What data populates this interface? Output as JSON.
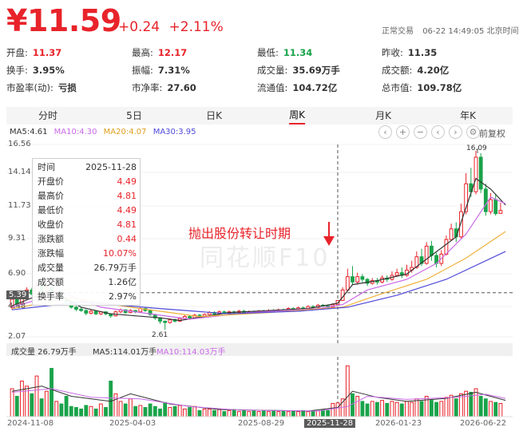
{
  "quote": {
    "price": "¥11.59",
    "change": "+0.24",
    "change_pct": "+2.11%",
    "status": "正常交易",
    "time": "06-22 14:49:05 北京时间",
    "fields": [
      {
        "label": "开盘:",
        "value": "11.37",
        "color": "red"
      },
      {
        "label": "最高:",
        "value": "12.17",
        "color": "red"
      },
      {
        "label": "最低:",
        "value": "11.34",
        "color": "green"
      },
      {
        "label": "昨收:",
        "value": "11.35",
        "color": ""
      },
      {
        "label": "换手:",
        "value": "3.95%",
        "color": ""
      },
      {
        "label": "振幅:",
        "value": "7.31%",
        "color": ""
      },
      {
        "label": "成交量:",
        "value": "35.69万手",
        "color": ""
      },
      {
        "label": "成交额:",
        "value": "4.20亿",
        "color": ""
      },
      {
        "label": "市盈率(动):",
        "value": "亏损",
        "color": ""
      },
      {
        "label": "市净率:",
        "value": "27.60",
        "color": ""
      },
      {
        "label": "流通值:",
        "value": "104.72亿",
        "color": ""
      },
      {
        "label": "总市值:",
        "value": "109.78亿",
        "color": ""
      }
    ]
  },
  "tabs": [
    "分时",
    "5日",
    "日K",
    "周K",
    "月K",
    "年K"
  ],
  "active_tab": "周K",
  "ma_legend": {
    "ma5": "MA5:4.61",
    "ma10": "MA10:4.30",
    "ma20": "MA20:4.07",
    "ma30": "MA30:3.95"
  },
  "toolbar": {
    "prev_icon": "chevron-left-icon",
    "zoom_in_icon": "plus-icon",
    "zoom_out_icon": "minus-icon",
    "back_icon": "chevron-left-icon",
    "forward_icon": "chevron-right-icon",
    "settings_icon": "gear-icon",
    "restore_label": "前复权"
  },
  "tooltip": {
    "rows": [
      {
        "k": "时间",
        "v": "2025-11-28",
        "c": "#333333"
      },
      {
        "k": "开盘价",
        "v": "4.49",
        "c": "#e8232a"
      },
      {
        "k": "最高价",
        "v": "4.81",
        "c": "#e8232a"
      },
      {
        "k": "最低价",
        "v": "4.49",
        "c": "#e8232a"
      },
      {
        "k": "收盘价",
        "v": "4.81",
        "c": "#e8232a"
      },
      {
        "k": "涨跌额",
        "v": "0.44",
        "c": "#e8232a"
      },
      {
        "k": "涨跌幅",
        "v": "10.07%",
        "c": "#e8232a"
      },
      {
        "k": "成交量",
        "v": "26.79万手",
        "c": "#333333"
      },
      {
        "k": "成交额",
        "v": "1.26亿",
        "c": "#333333"
      },
      {
        "k": "换手率",
        "v": "2.97%",
        "c": "#333333"
      }
    ]
  },
  "volume_header": {
    "vol": "成交量 26.79万手",
    "ma5": "MA5:114.01万手",
    "ma10": "MA10:114.03万手"
  },
  "annotation": "抛出股份转让时期",
  "watermark": "同花顺F10",
  "colors": {
    "up": "#e8232a",
    "down": "#1aa34a",
    "ma5": "#333333",
    "ma10": "#c96ae6",
    "ma20": "#f0b13a",
    "ma30": "#4f49d8"
  },
  "chart_data": {
    "type": "candlestick",
    "period": "weekly",
    "y_axis_labels": [
      "16.56",
      "14.14",
      "11.73",
      "9.31",
      "6.90",
      "4.48",
      "2.07"
    ],
    "ylim": [
      2.07,
      16.56
    ],
    "reference_price": "5.39",
    "max_label": "16.09",
    "min_label": "2.61",
    "x_labels": [
      "2024-11-08",
      "2025-04-03",
      "2025-08-29",
      "2025-11-28",
      "2026-01-23",
      "2026-06-22"
    ],
    "highlight_date": "2025-11-28",
    "candles": [
      [
        4.3,
        4.9,
        4.95,
        4.1
      ],
      [
        4.9,
        4.55,
        5.0,
        4.45
      ],
      [
        4.55,
        5.1,
        5.25,
        4.5
      ],
      [
        5.1,
        5.6,
        5.8,
        5.0
      ],
      [
        5.6,
        5.3,
        5.75,
        5.2
      ],
      [
        5.3,
        5.95,
        6.2,
        5.25
      ],
      [
        5.95,
        5.5,
        6.0,
        5.35
      ],
      [
        5.5,
        5.8,
        5.95,
        5.3
      ],
      [
        5.8,
        5.3,
        5.85,
        5.2
      ],
      [
        5.3,
        5.45,
        5.6,
        5.1
      ],
      [
        5.45,
        4.95,
        5.5,
        4.8
      ],
      [
        4.95,
        4.7,
        5.05,
        4.5
      ],
      [
        4.7,
        4.3,
        4.75,
        4.2
      ],
      [
        4.3,
        4.15,
        4.4,
        4.0
      ],
      [
        4.15,
        4.05,
        4.3,
        3.95
      ],
      [
        4.05,
        3.85,
        4.15,
        3.7
      ],
      [
        3.85,
        4.0,
        4.1,
        3.75
      ],
      [
        4.0,
        3.8,
        4.05,
        3.7
      ],
      [
        3.8,
        3.95,
        4.0,
        3.7
      ],
      [
        3.95,
        3.8,
        4.0,
        3.7
      ],
      [
        3.8,
        3.65,
        3.85,
        3.5
      ],
      [
        3.65,
        3.95,
        4.05,
        3.6
      ],
      [
        3.95,
        4.1,
        4.2,
        3.85
      ],
      [
        4.1,
        3.9,
        4.15,
        3.8
      ],
      [
        3.9,
        4.05,
        4.15,
        3.85
      ],
      [
        4.05,
        3.95,
        4.1,
        3.85
      ],
      [
        3.95,
        4.2,
        4.3,
        3.9
      ],
      [
        4.2,
        4.05,
        4.3,
        3.95
      ],
      [
        4.05,
        3.75,
        4.1,
        3.65
      ],
      [
        3.75,
        3.5,
        3.8,
        3.35
      ],
      [
        3.5,
        3.25,
        3.55,
        3.05
      ],
      [
        3.25,
        3.15,
        3.3,
        2.61
      ],
      [
        3.15,
        3.35,
        3.45,
        3.05
      ],
      [
        3.35,
        3.25,
        3.45,
        3.15
      ],
      [
        3.25,
        3.45,
        3.55,
        3.2
      ],
      [
        3.45,
        3.6,
        3.7,
        3.4
      ],
      [
        3.6,
        3.5,
        3.7,
        3.4
      ],
      [
        3.5,
        3.7,
        3.8,
        3.45
      ],
      [
        3.7,
        3.6,
        3.8,
        3.5
      ],
      [
        3.6,
        3.75,
        3.85,
        3.55
      ],
      [
        3.75,
        3.9,
        4.0,
        3.7
      ],
      [
        3.9,
        3.8,
        4.0,
        3.7
      ],
      [
        3.8,
        3.95,
        4.05,
        3.75
      ],
      [
        3.95,
        3.85,
        4.05,
        3.75
      ],
      [
        3.85,
        3.95,
        4.05,
        3.8
      ],
      [
        3.95,
        3.9,
        4.05,
        3.8
      ],
      [
        3.9,
        4.0,
        4.1,
        3.85
      ],
      [
        4.0,
        3.9,
        4.1,
        3.85
      ],
      [
        3.9,
        3.95,
        4.05,
        3.85
      ],
      [
        3.95,
        3.9,
        4.05,
        3.85
      ],
      [
        3.9,
        4.0,
        4.1,
        3.85
      ],
      [
        4.0,
        3.95,
        4.1,
        3.9
      ],
      [
        3.95,
        4.05,
        4.15,
        3.9
      ],
      [
        4.05,
        4.0,
        4.15,
        3.95
      ],
      [
        4.0,
        4.1,
        4.2,
        3.95
      ],
      [
        4.1,
        4.05,
        4.2,
        4.0
      ],
      [
        4.05,
        4.2,
        4.3,
        4.0
      ],
      [
        4.2,
        4.1,
        4.3,
        4.05
      ],
      [
        4.1,
        4.25,
        4.35,
        4.05
      ],
      [
        4.25,
        4.2,
        4.35,
        4.1
      ],
      [
        4.2,
        4.35,
        4.45,
        4.15
      ],
      [
        4.35,
        4.3,
        4.45,
        4.2
      ],
      [
        4.3,
        4.45,
        4.55,
        4.25
      ],
      [
        4.45,
        4.4,
        4.55,
        4.35
      ],
      [
        4.4,
        4.3,
        4.5,
        4.2
      ],
      [
        4.3,
        4.49,
        4.6,
        4.25
      ],
      [
        4.49,
        4.81,
        4.81,
        4.49
      ],
      [
        4.81,
        5.6,
        5.8,
        4.8
      ],
      [
        5.6,
        6.6,
        7.2,
        5.5
      ],
      [
        6.6,
        6.2,
        7.4,
        6.0
      ],
      [
        6.2,
        6.6,
        6.9,
        6.0
      ],
      [
        6.6,
        6.4,
        6.8,
        6.2
      ],
      [
        6.4,
        6.1,
        6.5,
        5.9
      ],
      [
        6.1,
        6.3,
        6.5,
        6.0
      ],
      [
        6.3,
        6.2,
        6.5,
        6.0
      ],
      [
        6.2,
        6.5,
        6.7,
        6.1
      ],
      [
        6.5,
        6.4,
        6.7,
        6.2
      ],
      [
        6.4,
        6.7,
        7.0,
        6.3
      ],
      [
        6.7,
        6.9,
        7.2,
        6.6
      ],
      [
        6.9,
        6.7,
        7.3,
        6.5
      ],
      [
        6.7,
        7.1,
        7.5,
        6.6
      ],
      [
        7.1,
        7.3,
        7.8,
        6.9
      ],
      [
        7.3,
        8.1,
        8.5,
        7.2
      ],
      [
        8.1,
        7.6,
        8.7,
        7.4
      ],
      [
        7.6,
        8.9,
        9.2,
        7.5
      ],
      [
        8.9,
        8.2,
        9.3,
        7.8
      ],
      [
        8.2,
        7.6,
        8.4,
        7.3
      ],
      [
        7.6,
        8.3,
        8.6,
        7.4
      ],
      [
        8.3,
        9.4,
        9.7,
        8.2
      ],
      [
        9.4,
        10.2,
        10.6,
        9.3
      ],
      [
        10.2,
        9.6,
        10.7,
        9.2
      ],
      [
        9.6,
        11.5,
        12.1,
        9.5
      ],
      [
        11.5,
        13.6,
        14.4,
        11.3
      ],
      [
        13.6,
        13.0,
        14.8,
        12.6
      ],
      [
        13.0,
        15.6,
        16.09,
        12.8
      ],
      [
        15.6,
        13.2,
        15.9,
        12.9
      ],
      [
        13.2,
        11.5,
        13.6,
        11.2
      ],
      [
        11.5,
        12.4,
        12.9,
        11.3
      ],
      [
        12.4,
        11.35,
        12.8,
        11.2
      ],
      [
        11.37,
        11.59,
        12.17,
        11.34
      ]
    ],
    "ma_series": [
      {
        "name": "MA5",
        "color": "#333333",
        "values": [
          [
            0,
            4.4
          ],
          [
            8,
            5.6
          ],
          [
            14,
            4.3
          ],
          [
            20,
            3.8
          ],
          [
            30,
            3.5
          ],
          [
            34,
            3.3
          ],
          [
            44,
            3.9
          ],
          [
            60,
            4.2
          ],
          [
            66,
            4.6
          ],
          [
            69,
            6.0
          ],
          [
            74,
            6.3
          ],
          [
            80,
            6.8
          ],
          [
            85,
            8.2
          ],
          [
            90,
            9.6
          ],
          [
            94,
            14.0
          ],
          [
            97,
            13.2
          ],
          [
            100,
            12.0
          ]
        ]
      },
      {
        "name": "MA10",
        "color": "#c96ae6",
        "values": [
          [
            0,
            4.3
          ],
          [
            10,
            5.4
          ],
          [
            18,
            4.3
          ],
          [
            30,
            3.7
          ],
          [
            36,
            3.4
          ],
          [
            48,
            3.9
          ],
          [
            62,
            4.2
          ],
          [
            67,
            4.5
          ],
          [
            72,
            5.6
          ],
          [
            80,
            6.4
          ],
          [
            86,
            7.6
          ],
          [
            92,
            9.8
          ],
          [
            97,
            12.6
          ],
          [
            100,
            12.1
          ]
        ]
      },
      {
        "name": "MA20",
        "color": "#f0b13a",
        "values": [
          [
            0,
            4.2
          ],
          [
            12,
            5.0
          ],
          [
            24,
            4.3
          ],
          [
            38,
            3.6
          ],
          [
            52,
            3.9
          ],
          [
            67,
            4.3
          ],
          [
            74,
            5.2
          ],
          [
            84,
            6.4
          ],
          [
            92,
            8.0
          ],
          [
            100,
            10.0
          ]
        ]
      },
      {
        "name": "MA30",
        "color": "#4f49d8",
        "values": [
          [
            0,
            4.1
          ],
          [
            14,
            4.7
          ],
          [
            30,
            4.2
          ],
          [
            44,
            3.8
          ],
          [
            58,
            4.0
          ],
          [
            68,
            4.3
          ],
          [
            78,
            5.2
          ],
          [
            88,
            6.4
          ],
          [
            100,
            8.5
          ]
        ]
      }
    ],
    "volumes": [
      55,
      40,
      70,
      60,
      45,
      80,
      35,
      50,
      95,
      30,
      25,
      40,
      20,
      18,
      15,
      22,
      20,
      15,
      25,
      18,
      70,
      45,
      30,
      25,
      35,
      20,
      22,
      18,
      25,
      20,
      15,
      28,
      18,
      20,
      22,
      15,
      18,
      20,
      12,
      15,
      15,
      12,
      14,
      10,
      12,
      14,
      10,
      12,
      10,
      12,
      10,
      11,
      10,
      12,
      10,
      12,
      10,
      11,
      10,
      12,
      10,
      12,
      11,
      13,
      12,
      26,
      27,
      35,
      100,
      45,
      40,
      30,
      25,
      30,
      28,
      32,
      26,
      30,
      28,
      25,
      30,
      28,
      35,
      30,
      40,
      32,
      28,
      30,
      38,
      42,
      35,
      45,
      50,
      48,
      55,
      40,
      35,
      30,
      28,
      26
    ],
    "vol_ma5": [
      [
        0,
        50
      ],
      [
        6,
        60
      ],
      [
        12,
        40
      ],
      [
        20,
        30
      ],
      [
        24,
        45
      ],
      [
        32,
        25
      ],
      [
        42,
        14
      ],
      [
        60,
        11
      ],
      [
        66,
        18
      ],
      [
        69,
        50
      ],
      [
        74,
        38
      ],
      [
        80,
        30
      ],
      [
        88,
        36
      ],
      [
        94,
        48
      ],
      [
        100,
        32
      ]
    ],
    "vol_ma10": [
      [
        0,
        48
      ],
      [
        8,
        55
      ],
      [
        16,
        38
      ],
      [
        26,
        35
      ],
      [
        36,
        20
      ],
      [
        46,
        13
      ],
      [
        62,
        11
      ],
      [
        68,
        20
      ],
      [
        72,
        40
      ],
      [
        80,
        34
      ],
      [
        90,
        38
      ],
      [
        96,
        44
      ],
      [
        100,
        36
      ]
    ]
  }
}
